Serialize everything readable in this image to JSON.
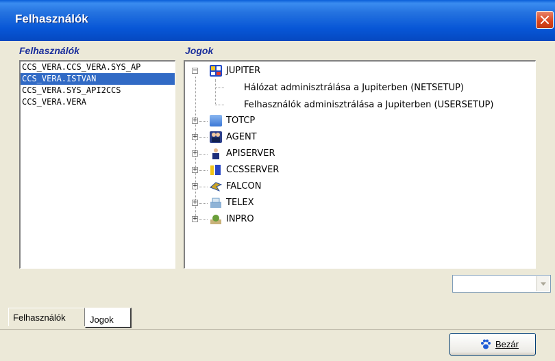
{
  "window": {
    "title": "Felhasználók"
  },
  "users": {
    "heading": "Felhasználók",
    "items": [
      "CCS_VERA.CCS_VERA.SYS_AP",
      "CCS_VERA.ISTVAN",
      "CCS_VERA.SYS_API2CCS",
      "CCS_VERA.VERA"
    ],
    "selected_index": 1
  },
  "rights": {
    "heading": "Jogok",
    "tree": [
      {
        "label": "JUPITER",
        "expanded": true,
        "icon": "jupiter-icon",
        "color": "#2049C8",
        "children": [
          "Hálózat adminisztrálása a Jupiterben (NETSETUP)",
          "Felhasználók adminisztrálása a Jupiterben (USERSETUP)"
        ]
      },
      {
        "label": "TOTCP",
        "expanded": false,
        "icon": "totcp-icon",
        "color": "#3A77D6"
      },
      {
        "label": "AGENT",
        "expanded": false,
        "icon": "agent-icon",
        "color": "#2C3F8A"
      },
      {
        "label": "APISERVER",
        "expanded": false,
        "icon": "apiserver-icon",
        "color": "#1F2F7A"
      },
      {
        "label": "CCSSERVER",
        "expanded": false,
        "icon": "ccsserver-icon",
        "color": "#2846C4"
      },
      {
        "label": "FALCON",
        "expanded": false,
        "icon": "falcon-icon",
        "color": "#C9A227"
      },
      {
        "label": "TELEX",
        "expanded": false,
        "icon": "telex-icon",
        "color": "#6A9AC6"
      },
      {
        "label": "INPRO",
        "expanded": false,
        "icon": "inpro-icon",
        "color": "#6A9E3A"
      }
    ]
  },
  "combo": {
    "value": ""
  },
  "tabs": [
    {
      "label": "Felhasználók",
      "active": false
    },
    {
      "label": "Jogok",
      "active": true
    }
  ],
  "close_button": {
    "label": "Bezár"
  }
}
